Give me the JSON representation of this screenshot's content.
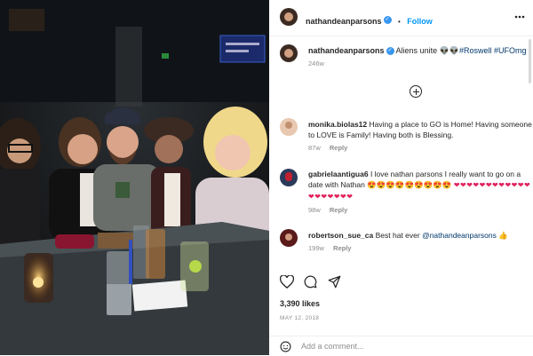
{
  "post": {
    "author": "nathandeanparsons",
    "verified_mark": "✓",
    "follow_label": "Follow",
    "separator": "•"
  },
  "caption": {
    "username": "nathandeanparsons",
    "text": "Aliens unite",
    "emoji": "👽👽",
    "tags": "#Roswell #UFOmg",
    "age": "246w"
  },
  "comments": [
    {
      "username": "monika.biolas12",
      "text": "Having a place to GO is Home! Having someone to LOVE is Family! Having both is Blessing.",
      "age": "87w",
      "reply": "Reply"
    },
    {
      "username": "gabrielaantigua6",
      "text": "I love nathan parsons I really want to go on a date with Nathan",
      "emoji": "😍😍😍😍😍😍😍😍😍",
      "hearts": "❤❤❤❤❤❤❤❤❤❤❤❤❤❤❤❤❤❤❤",
      "age": "98w",
      "reply": "Reply"
    },
    {
      "username": "robertson_sue_ca",
      "text": "Best hat ever",
      "mention": "@nathandeanparsons",
      "emoji": "👍",
      "age": "199w",
      "reply": "Reply"
    }
  ],
  "likes": "3,390 likes",
  "date": "MAY 12, 2018",
  "add_comment": {
    "placeholder": "Add a comment..."
  },
  "icons": [
    "heart-icon",
    "comment-icon",
    "share-icon",
    "add-comment-icon",
    "emoji-icon"
  ],
  "colors": {
    "link": "#0095f6",
    "tag": "#00376b",
    "muted": "#8e8e8e",
    "verified": "#3897f0"
  }
}
